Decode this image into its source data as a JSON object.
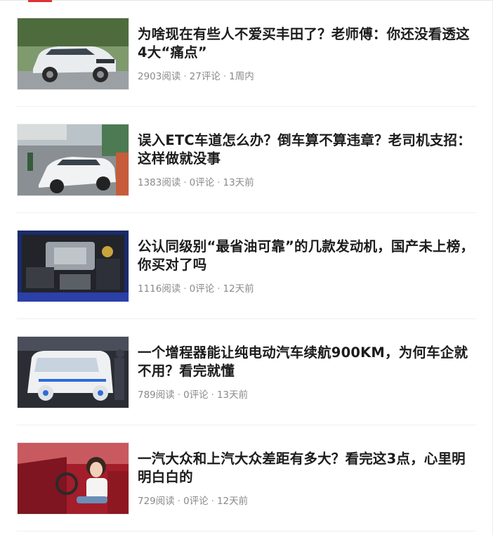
{
  "feed": {
    "items": [
      {
        "title": "为啥现在有些人不爱买丰田了？老师傅：你还没看透这4大“痛点”",
        "reads": "2903阅读",
        "comments": "27评论",
        "time": "1周内",
        "thumb_icon": "white-suv-photo"
      },
      {
        "title": "误入ETC车道怎么办？倒车算不算违章？老司机支招：这样做就没事",
        "reads": "1383阅读",
        "comments": "0评论",
        "time": "13天前",
        "thumb_icon": "toll-lane-car-photo"
      },
      {
        "title": "公认同级别“最省油可靠”的几款发动机，国产未上榜，你买对了吗",
        "reads": "1116阅读",
        "comments": "0评论",
        "time": "12天前",
        "thumb_icon": "engine-bay-photo"
      },
      {
        "title": "一个增程器能让纯电动汽车续航900KM，为何车企就不用？看完就懂",
        "reads": "789阅读",
        "comments": "0评论",
        "time": "13天前",
        "thumb_icon": "electric-concept-car-photo"
      },
      {
        "title": "一汽大众和上汽大众差距有多大？看完这3点，心里明明白白的",
        "reads": "729阅读",
        "comments": "0评论",
        "time": "12天前",
        "thumb_icon": "woman-in-red-car-photo"
      }
    ],
    "separator": "·"
  },
  "colors": {
    "accent": "#e03131",
    "title": "#1c1c1c",
    "meta": "#8a8a8a",
    "divider": "#f0f0f0"
  }
}
